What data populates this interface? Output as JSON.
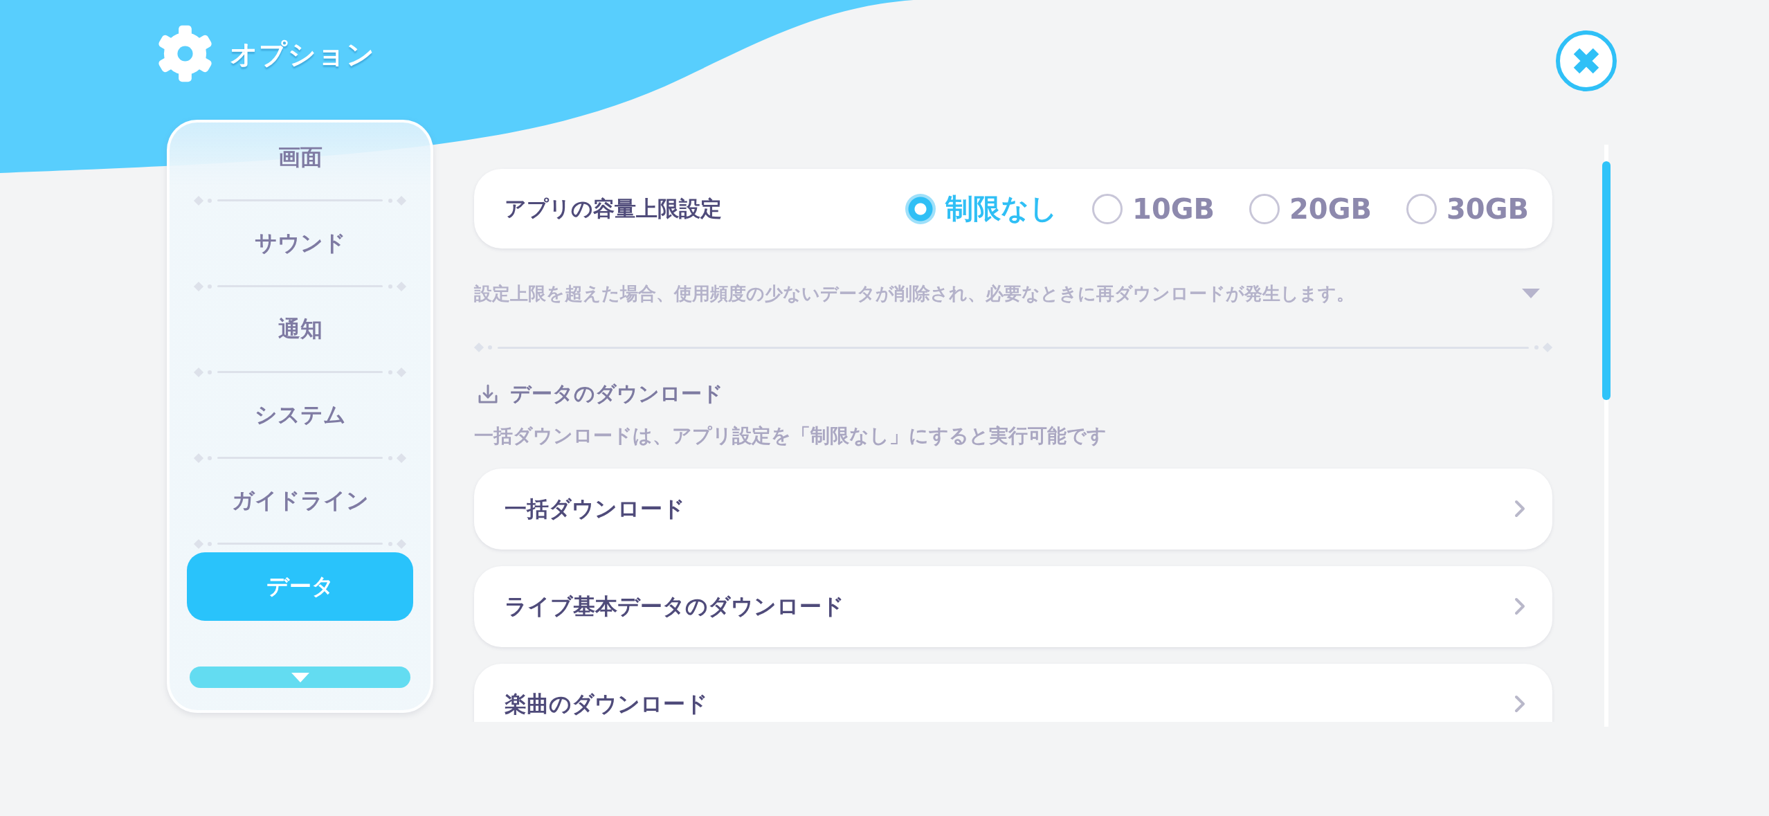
{
  "header": {
    "title": "オプション"
  },
  "sidebar": {
    "items": [
      {
        "label": "画面",
        "selected": false
      },
      {
        "label": "サウンド",
        "selected": false
      },
      {
        "label": "通知",
        "selected": false
      },
      {
        "label": "システム",
        "selected": false
      },
      {
        "label": "ガイドライン",
        "selected": false
      },
      {
        "label": "データ",
        "selected": true
      }
    ]
  },
  "capacity_setting": {
    "label": "アプリの容量上限設定",
    "options": [
      {
        "label": "制限なし",
        "selected": true
      },
      {
        "label": "10GB",
        "selected": false
      },
      {
        "label": "20GB",
        "selected": false
      },
      {
        "label": "30GB",
        "selected": false
      }
    ],
    "note": "設定上限を超えた場合、使用頻度の少ないデータが削除され、必要なときに再ダウンロードが発生します。"
  },
  "download_section": {
    "heading": "データのダウンロード",
    "description": "一括ダウンロードは、アプリ設定を「制限なし」にすると実行可能です",
    "items": [
      {
        "label": "一括ダウンロード"
      },
      {
        "label": "ライブ基本データのダウンロード"
      },
      {
        "label": "楽曲のダウンロード"
      }
    ]
  }
}
